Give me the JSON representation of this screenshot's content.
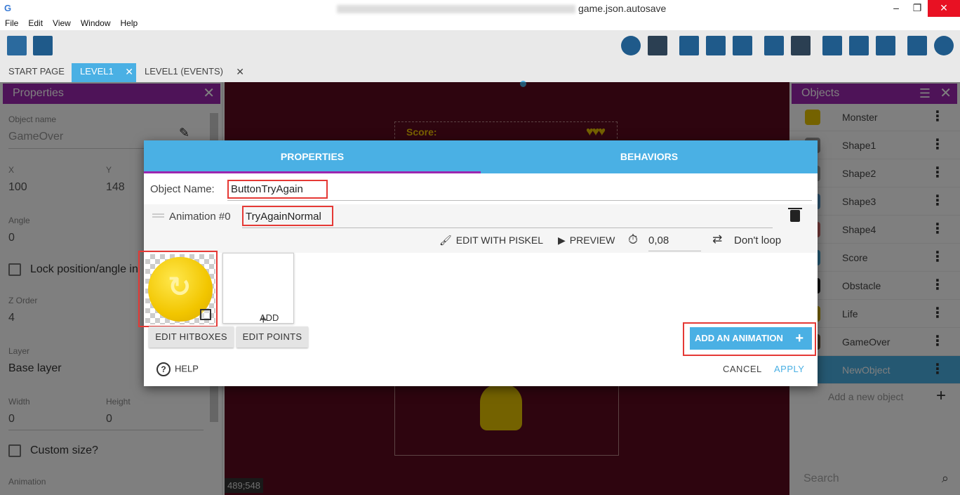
{
  "window": {
    "title": "game.json.autosave",
    "min": "–",
    "restore": "❐",
    "close": "✕"
  },
  "menu": [
    "File",
    "Edit",
    "View",
    "Window",
    "Help"
  ],
  "tabs": [
    {
      "label": "START PAGE",
      "active": false
    },
    {
      "label": "LEVEL1",
      "active": true,
      "close": "✕"
    },
    {
      "label": "LEVEL1 (EVENTS)",
      "active": false,
      "close": "✕"
    }
  ],
  "properties_panel": {
    "title": "Properties",
    "close": "✕",
    "object_name_label": "Object name",
    "object_name_value": "GameOver",
    "x_label": "X",
    "x_value": "100",
    "y_label": "Y",
    "y_value": "148",
    "angle_label": "Angle",
    "angle_value": "0",
    "lock_label": "Lock position/angle in",
    "zorder_label": "Z Order",
    "zorder_value": "4",
    "layer_label": "Layer",
    "layer_value": "Base layer",
    "width_label": "Width",
    "width_value": "0",
    "height_label": "Height",
    "height_value": "0",
    "custom_size_label": "Custom size?",
    "animation_label": "Animation"
  },
  "canvas": {
    "score_label": "Score:",
    "hearts": "♥♥♥",
    "coords": "489;548"
  },
  "objects_panel": {
    "title": "Objects",
    "filter_icon": "☰",
    "close": "✕",
    "items": [
      {
        "name": "Monster",
        "color": "#e8c400"
      },
      {
        "name": "Shape1",
        "color": "#9e9e9e"
      },
      {
        "name": "Shape2",
        "color": "#b0b0b0"
      },
      {
        "name": "Shape3",
        "color": "#5ba3d9"
      },
      {
        "name": "Shape4",
        "color": "#e57373"
      },
      {
        "name": "Score",
        "color": "#4ab0e4"
      },
      {
        "name": "Obstacle",
        "color": "#222222"
      },
      {
        "name": "Life",
        "color": "#e6c000"
      },
      {
        "name": "GameOver",
        "color": "#7a5c3a"
      },
      {
        "name": "NewObject",
        "color": "#4ab0e4",
        "selected": true
      }
    ],
    "kebab": "⋮",
    "add_label": "Add a new object",
    "add_plus": "+",
    "search_placeholder": "Search",
    "search_icon": "⌕"
  },
  "dialog": {
    "tab_properties": "PROPERTIES",
    "tab_behaviors": "BEHAVIORS",
    "object_name_label": "Object Name:",
    "object_name_value": "ButtonTryAgain",
    "animation_label": "Animation #0",
    "animation_name": "TryAgainNormal",
    "edit_piskel": "EDIT WITH PISKEL",
    "preview": "PREVIEW",
    "timer_value": "0,08",
    "loop_label": "Don't loop",
    "add_label": "ADD",
    "add_plus": "+",
    "edit_hitboxes": "EDIT HITBOXES",
    "edit_points": "EDIT POINTS",
    "add_animation": "ADD AN ANIMATION",
    "add_animation_plus": "+",
    "help": "HELP",
    "help_icon": "?",
    "cancel": "CANCEL",
    "apply": "APPLY",
    "accent": "#4ab0e4",
    "highlight": "#e53935"
  }
}
